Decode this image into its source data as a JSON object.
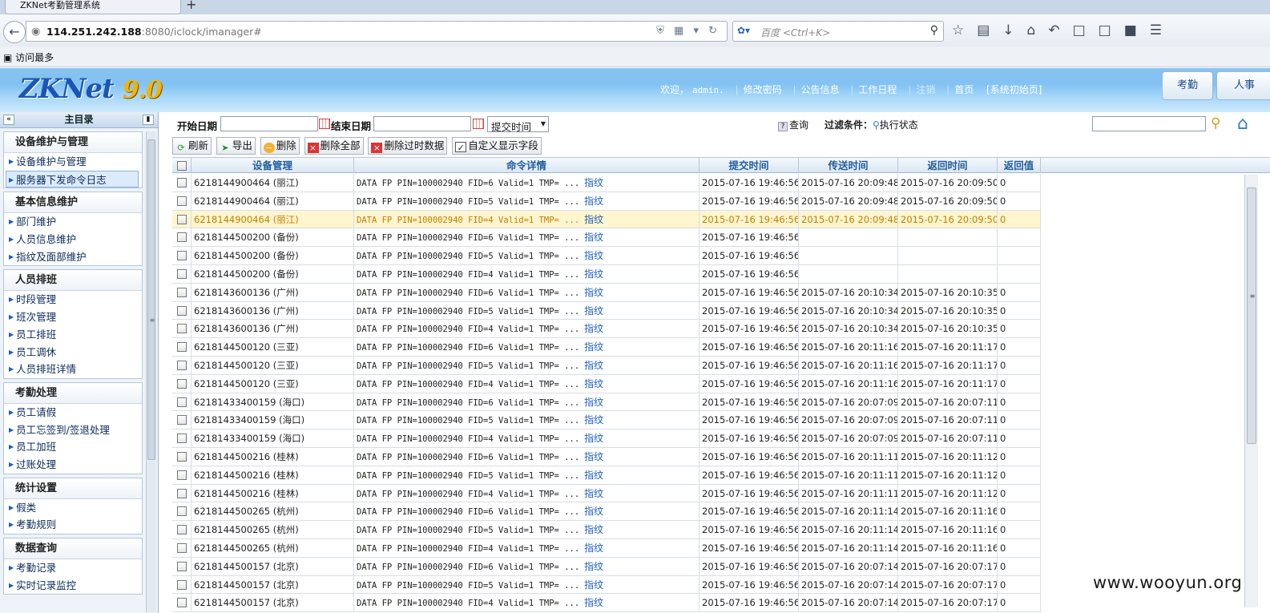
{
  "browser": {
    "tab_title": "ZKNet考勤管理系统",
    "url_host": "114.251.242.188",
    "url_path": ":8080/iclock/imanager#",
    "search_placeholder": "百度 <Ctrl+K>",
    "bookmark": "访问最多"
  },
  "header": {
    "logo_main": "ZKNet",
    "logo_version": "9.0",
    "welcome": "欢迎，",
    "user": "admin.",
    "nav": [
      "修改密码",
      "公告信息",
      "工作日程",
      "注销",
      "首页",
      "[系统初始页]"
    ],
    "buttons": [
      "考勤",
      "人事"
    ]
  },
  "sidebar": {
    "title": "主目录",
    "groups": [
      {
        "title": "设备维护与管理",
        "items": [
          "设备维护与管理",
          "服务器下发命令日志"
        ]
      },
      {
        "title": "基本信息维护",
        "items": [
          "部门维护",
          "人员信息维护",
          "指纹及面部维护"
        ]
      },
      {
        "title": "人员排班",
        "items": [
          "时段管理",
          "班次管理",
          "员工排班",
          "员工调休",
          "人员排班详情"
        ]
      },
      {
        "title": "考勤处理",
        "items": [
          "员工请假",
          "员工忘签到/签退处理",
          "员工加班",
          "过账处理"
        ]
      },
      {
        "title": "统计设置",
        "items": [
          "假类",
          "考勤规则"
        ]
      },
      {
        "title": "数据查询",
        "items": [
          "考勤记录",
          "实时记录监控"
        ]
      }
    ],
    "selected_item": "服务器下发命令日志"
  },
  "filter": {
    "start_label": "开始日期",
    "end_label": "结束日期",
    "time_select": "提交时间",
    "query": "查询",
    "filter_label": "过滤条件：",
    "exec_status": "执行状态"
  },
  "actions": [
    "刷新",
    "导出",
    "删除",
    "删除全部",
    "删除过时数据",
    "自定义显示字段"
  ],
  "table": {
    "columns": [
      "设备管理",
      "命令详情",
      "提交时间",
      "传送时间",
      "返回时间",
      "返回值"
    ],
    "fp_link": "指纹",
    "rows": [
      [
        "6218144900464 (丽江)",
        "DATA FP PIN=100002940 FID=6 Valid=1 TMP= ...",
        "2015-07-16 19:46:56",
        "2015-07-16 20:09:48",
        "2015-07-16 20:09:50",
        "0"
      ],
      [
        "6218144900464 (丽江)",
        "DATA FP PIN=100002940 FID=5 Valid=1 TMP= ...",
        "2015-07-16 19:46:56",
        "2015-07-16 20:09:48",
        "2015-07-16 20:09:50",
        "0"
      ],
      [
        "6218144900464 (丽江)",
        "DATA FP PIN=100002940 FID=4 Valid=1 TMP= ...",
        "2015-07-16 19:46:56",
        "2015-07-16 20:09:48",
        "2015-07-16 20:09:50",
        "0"
      ],
      [
        "6218144500200 (备份)",
        "DATA FP PIN=100002940 FID=6 Valid=1 TMP= ...",
        "2015-07-16 19:46:56",
        "",
        "",
        ""
      ],
      [
        "6218144500200 (备份)",
        "DATA FP PIN=100002940 FID=5 Valid=1 TMP= ...",
        "2015-07-16 19:46:56",
        "",
        "",
        ""
      ],
      [
        "6218144500200 (备份)",
        "DATA FP PIN=100002940 FID=4 Valid=1 TMP= ...",
        "2015-07-16 19:46:56",
        "",
        "",
        ""
      ],
      [
        "6218143600136 (广州)",
        "DATA FP PIN=100002940 FID=6 Valid=1 TMP= ...",
        "2015-07-16 19:46:56",
        "2015-07-16 20:10:34",
        "2015-07-16 20:10:35",
        "0"
      ],
      [
        "6218143600136 (广州)",
        "DATA FP PIN=100002940 FID=5 Valid=1 TMP= ...",
        "2015-07-16 19:46:56",
        "2015-07-16 20:10:34",
        "2015-07-16 20:10:35",
        "0"
      ],
      [
        "6218143600136 (广州)",
        "DATA FP PIN=100002940 FID=4 Valid=1 TMP= ...",
        "2015-07-16 19:46:56",
        "2015-07-16 20:10:34",
        "2015-07-16 20:10:35",
        "0"
      ],
      [
        "6218144500120 (三亚)",
        "DATA FP PIN=100002940 FID=6 Valid=1 TMP= ...",
        "2015-07-16 19:46:56",
        "2015-07-16 20:11:16",
        "2015-07-16 20:11:17",
        "0"
      ],
      [
        "6218144500120 (三亚)",
        "DATA FP PIN=100002940 FID=5 Valid=1 TMP= ...",
        "2015-07-16 19:46:56",
        "2015-07-16 20:11:16",
        "2015-07-16 20:11:17",
        "0"
      ],
      [
        "6218144500120 (三亚)",
        "DATA FP PIN=100002940 FID=4 Valid=1 TMP= ...",
        "2015-07-16 19:46:56",
        "2015-07-16 20:11:16",
        "2015-07-16 20:11:17",
        "0"
      ],
      [
        "62181433400159 (海口)",
        "DATA FP PIN=100002940 FID=6 Valid=1 TMP= ...",
        "2015-07-16 19:46:56",
        "2015-07-16 20:07:09",
        "2015-07-16 20:07:11",
        "0"
      ],
      [
        "62181433400159 (海口)",
        "DATA FP PIN=100002940 FID=5 Valid=1 TMP= ...",
        "2015-07-16 19:46:56",
        "2015-07-16 20:07:09",
        "2015-07-16 20:07:11",
        "0"
      ],
      [
        "62181433400159 (海口)",
        "DATA FP PIN=100002940 FID=4 Valid=1 TMP= ...",
        "2015-07-16 19:46:56",
        "2015-07-16 20:07:09",
        "2015-07-16 20:07:11",
        "0"
      ],
      [
        "6218144500216 (桂林)",
        "DATA FP PIN=100002940 FID=6 Valid=1 TMP= ...",
        "2015-07-16 19:46:56",
        "2015-07-16 20:11:11",
        "2015-07-16 20:11:12",
        "0"
      ],
      [
        "6218144500216 (桂林)",
        "DATA FP PIN=100002940 FID=5 Valid=1 TMP= ...",
        "2015-07-16 19:46:56",
        "2015-07-16 20:11:11",
        "2015-07-16 20:11:12",
        "0"
      ],
      [
        "6218144500216 (桂林)",
        "DATA FP PIN=100002940 FID=4 Valid=1 TMP= ...",
        "2015-07-16 19:46:56",
        "2015-07-16 20:11:11",
        "2015-07-16 20:11:12",
        "0"
      ],
      [
        "6218144500265 (杭州)",
        "DATA FP PIN=100002940 FID=6 Valid=1 TMP= ...",
        "2015-07-16 19:46:56",
        "2015-07-16 20:11:14",
        "2015-07-16 20:11:16",
        "0"
      ],
      [
        "6218144500265 (杭州)",
        "DATA FP PIN=100002940 FID=5 Valid=1 TMP= ...",
        "2015-07-16 19:46:56",
        "2015-07-16 20:11:14",
        "2015-07-16 20:11:16",
        "0"
      ],
      [
        "6218144500265 (杭州)",
        "DATA FP PIN=100002940 FID=4 Valid=1 TMP= ...",
        "2015-07-16 19:46:56",
        "2015-07-16 20:11:14",
        "2015-07-16 20:11:16",
        "0"
      ],
      [
        "6218144500157 (北京)",
        "DATA FP PIN=100002940 FID=6 Valid=1 TMP= ...",
        "2015-07-16 19:46:56",
        "2015-07-16 20:07:14",
        "2015-07-16 20:07:17",
        "0"
      ],
      [
        "6218144500157 (北京)",
        "DATA FP PIN=100002940 FID=5 Valid=1 TMP= ...",
        "2015-07-16 19:46:56",
        "2015-07-16 20:07:14",
        "2015-07-16 20:07:17",
        "0"
      ],
      [
        "6218144500157 (北京)",
        "DATA FP PIN=100002940 FID=4 Valid=1 TMP= ...",
        "2015-07-16 19:46:56",
        "2015-07-16 20:07:14",
        "2015-07-16 20:07:17",
        "0"
      ]
    ],
    "highlighted_row": 2
  },
  "watermark": "www.wooyun.org",
  "colors": {
    "header_blue": "#4fa5e8",
    "link_blue": "#1d5fb8",
    "highlight_row": "#fff6cf"
  }
}
